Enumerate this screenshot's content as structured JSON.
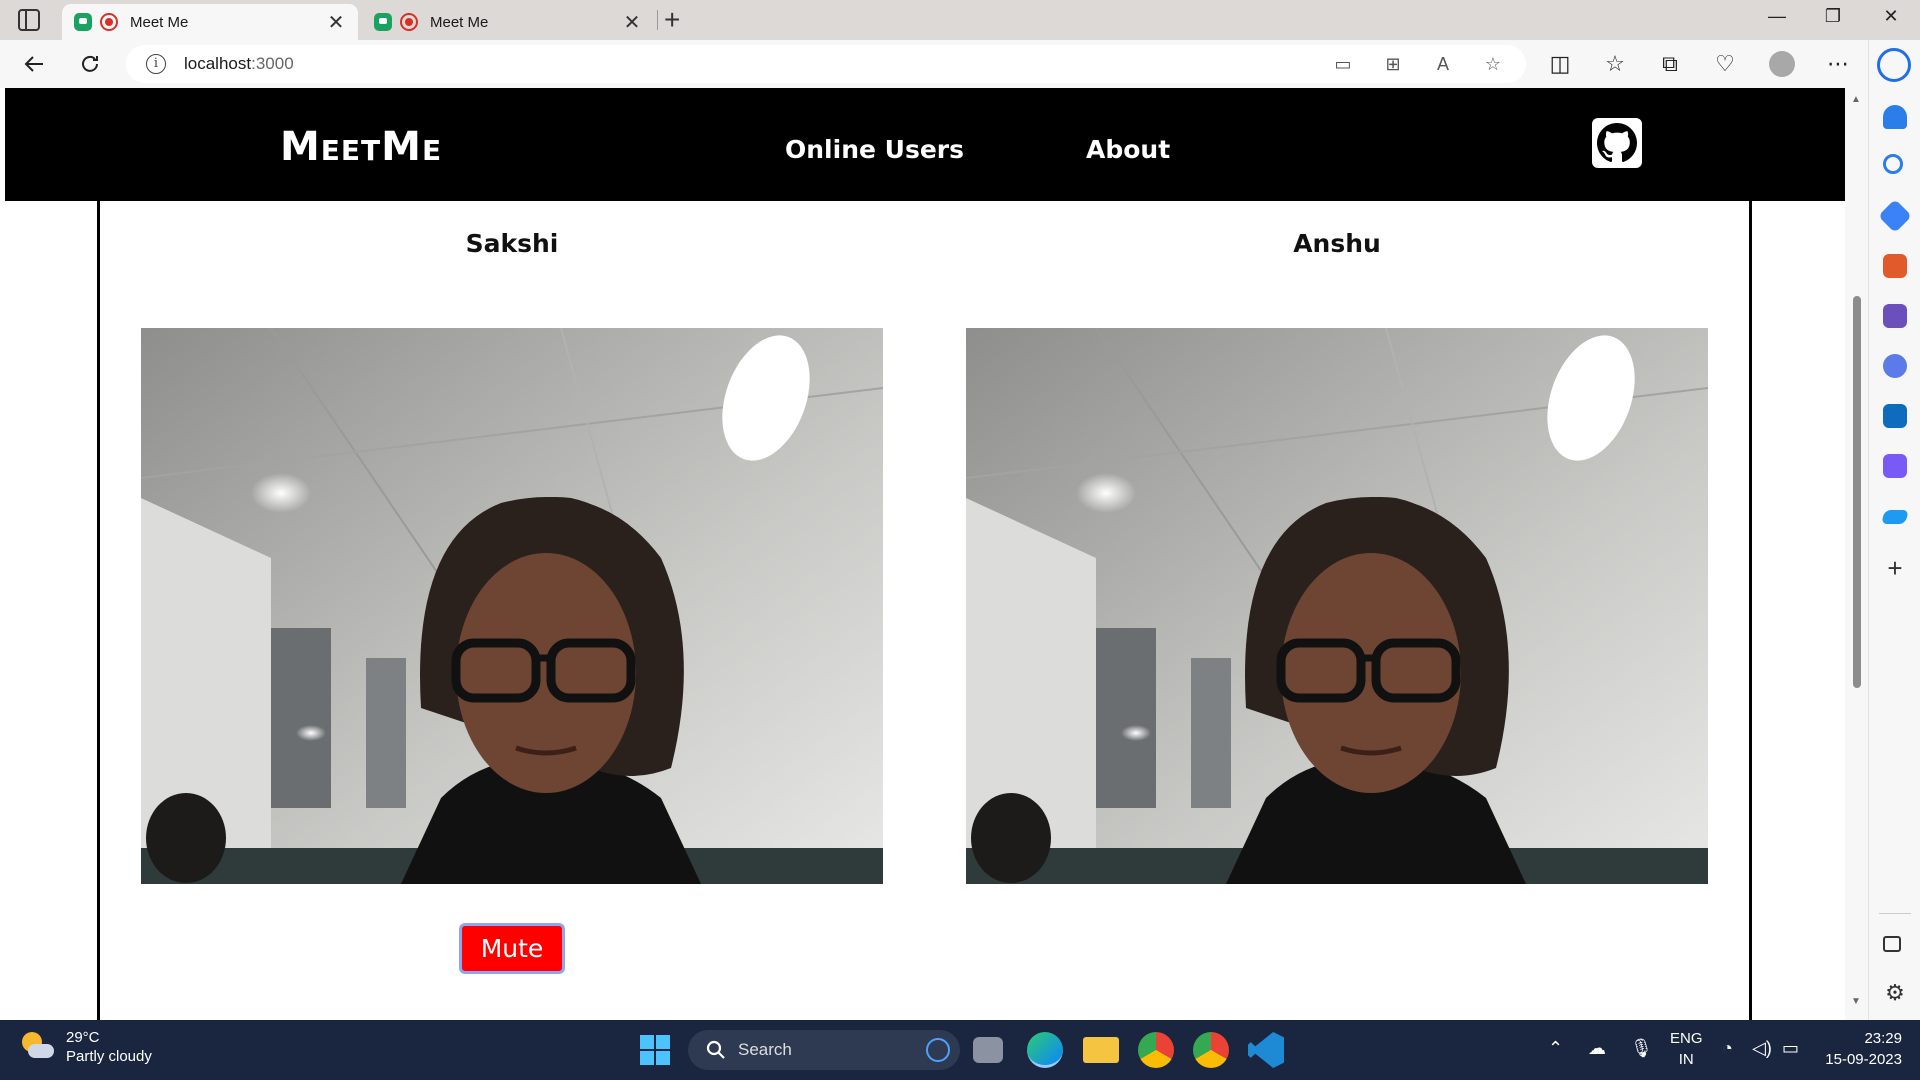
{
  "browser": {
    "tabs": [
      {
        "title": "Meet Me",
        "active": true
      },
      {
        "title": "Meet Me",
        "active": false
      }
    ],
    "address": {
      "host": "localhost",
      "port": ":3000"
    }
  },
  "app": {
    "brand": "MeetMe",
    "nav": {
      "online_users": "Online Users",
      "about": "About"
    },
    "users": [
      {
        "name": "Sakshi"
      },
      {
        "name": "Anshu"
      }
    ],
    "mute_label": "Mute",
    "colors": {
      "nav_bg": "#000000",
      "mute_bg": "#ff0000",
      "mute_border": "#8ea6f2"
    }
  },
  "taskbar": {
    "weather": {
      "temp": "29°C",
      "condition": "Partly cloudy"
    },
    "search_placeholder": "Search",
    "lang": {
      "line1": "ENG",
      "line2": "IN"
    },
    "clock": {
      "time": "23:29",
      "date": "15-09-2023"
    }
  }
}
